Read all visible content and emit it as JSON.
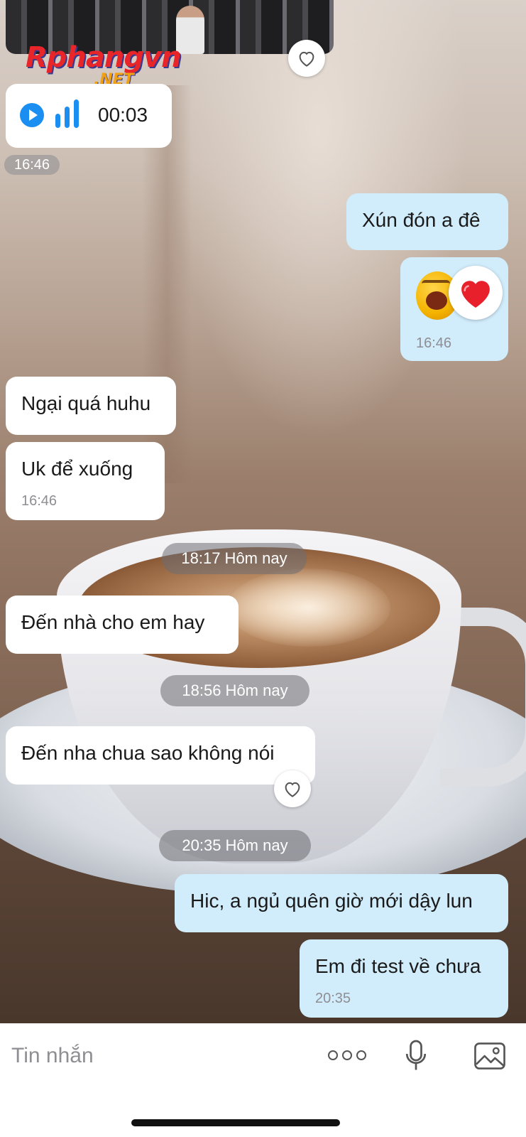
{
  "watermark": {
    "text": "Rphangvn",
    "sub": ".NET"
  },
  "messages": {
    "voice": {
      "duration": "00:03",
      "time": "16:46"
    },
    "m1": {
      "text": "Xún đón a đê"
    },
    "m2": {
      "time": "16:46"
    },
    "m3": {
      "text": "Ngại quá huhu"
    },
    "m4": {
      "text": "Uk để xuống",
      "time": "16:46"
    },
    "sep1": {
      "label": "18:17 Hôm nay"
    },
    "m5": {
      "text": "Đến nhà cho em hay"
    },
    "sep2": {
      "label": "18:56 Hôm nay"
    },
    "m6": {
      "text": "Đến nha chua sao không nói"
    },
    "sep3": {
      "label": "20:35 Hôm nay"
    },
    "m7": {
      "text": "Hic, a ngủ quên giờ mới dậy lun"
    },
    "m8": {
      "text": "Em đi test về chưa",
      "time": "20:35"
    }
  },
  "input": {
    "placeholder": "Tin nhắn"
  },
  "icons": {
    "more": "more-icon",
    "mic": "microphone-icon",
    "image": "image-icon",
    "heart_outline": "heart-outline-icon",
    "heart_reaction": "heart-reaction-icon",
    "emoji": "laughing-emoji-icon",
    "play": "play-icon",
    "waveform": "waveform-icon"
  },
  "colors": {
    "incoming_bubble": "#ffffff",
    "outgoing_bubble": "#d1ecfb",
    "accent": "#1b8ef2",
    "reaction_heart": "#e8202b"
  }
}
